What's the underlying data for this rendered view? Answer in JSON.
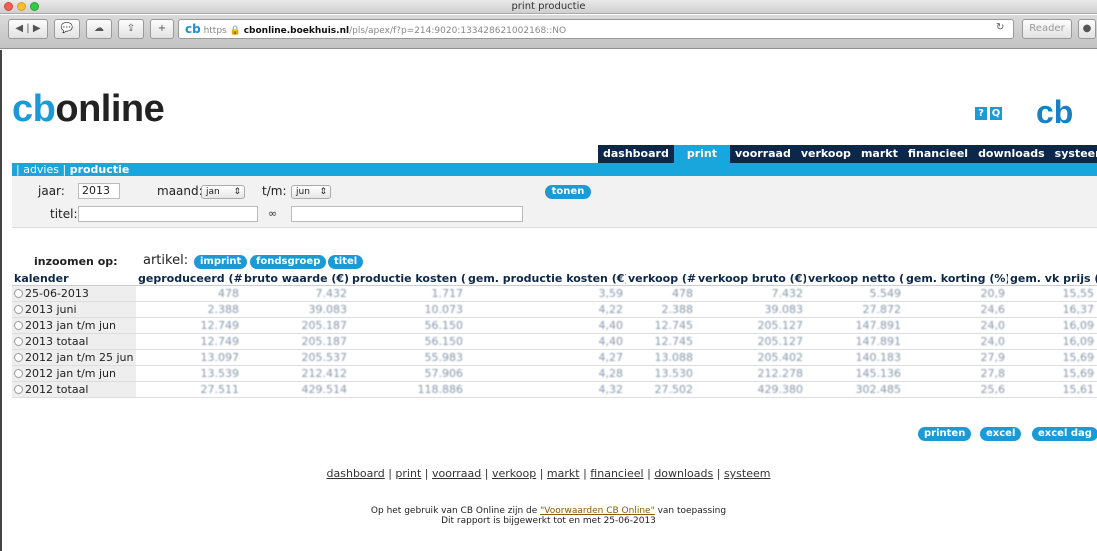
{
  "window": {
    "title": "print productie"
  },
  "browser": {
    "url_prefix": "https",
    "url_host": "cbonline.boekhuis.nl",
    "url_path": "/pls/apex/f?p=214:9020:133428621002168::NO",
    "reader_label": "Reader"
  },
  "logo": {
    "brand_c": "cb",
    "brand_rest": "online"
  },
  "icons": {
    "help": "?",
    "search": "Q"
  },
  "mainnav": [
    {
      "label": "dashboard",
      "active": false
    },
    {
      "label": "print",
      "active": true
    },
    {
      "label": "voorraad",
      "active": false
    },
    {
      "label": "verkoop",
      "active": false
    },
    {
      "label": "markt",
      "active": false
    },
    {
      "label": "financieel",
      "active": false
    },
    {
      "label": "downloads",
      "active": false
    },
    {
      "label": "systeem",
      "active": false
    }
  ],
  "subnav": {
    "advies": "advies",
    "productie": "productie"
  },
  "filter": {
    "jaar_label": "jaar:",
    "jaar_value": "2013",
    "maand_label": "maand:",
    "maand_value": "jan",
    "tm_label": "t/m:",
    "tm_value": "jun",
    "tonen_label": "tonen",
    "titel_label": "titel:",
    "titel_value": "",
    "search_value": ""
  },
  "zoom": {
    "label": "inzoomen op:",
    "artikel_label": "artikel:",
    "buttons": [
      "imprint",
      "fondsgroep",
      "titel"
    ]
  },
  "table": {
    "columns": [
      "kalender",
      "geproduceerd (#)",
      "bruto waarde (€)",
      "productie kosten (€)",
      "gem. productie kosten (€)",
      "verkoop (#)",
      "verkoop bruto (€)",
      "verkoop netto (€)",
      "gem. korting (%)",
      "gem. vk prijs (€)"
    ],
    "rows": [
      [
        "25-06-2013",
        "478",
        "7.432",
        "1.717",
        "3,59",
        "478",
        "7.432",
        "5.549",
        "20,9",
        "15,55"
      ],
      [
        "2013 juni",
        "2.388",
        "39.083",
        "10.073",
        "4,22",
        "2.388",
        "39.083",
        "27.872",
        "24,6",
        "16,37"
      ],
      [
        "2013 jan t/m jun",
        "12.749",
        "205.187",
        "56.150",
        "4,40",
        "12.745",
        "205.127",
        "147.891",
        "24,0",
        "16,09"
      ],
      [
        "2013 totaal",
        "12.749",
        "205.187",
        "56.150",
        "4,40",
        "12.745",
        "205.127",
        "147.891",
        "24,0",
        "16,09"
      ],
      [
        "2012 jan t/m 25 jun",
        "13.097",
        "205.537",
        "55.983",
        "4,27",
        "13.088",
        "205.402",
        "140.183",
        "27,9",
        "15,69"
      ],
      [
        "2012 jan t/m jun",
        "13.539",
        "212.412",
        "57.906",
        "4,28",
        "13.530",
        "212.278",
        "145.136",
        "27,8",
        "15,69"
      ],
      [
        "2012 totaal",
        "27.511",
        "429.514",
        "118.886",
        "4,32",
        "27.502",
        "429.380",
        "302.485",
        "25,6",
        "15,61"
      ]
    ]
  },
  "actions": {
    "printen": "printen",
    "excel": "excel",
    "excel_dag": "excel dag"
  },
  "footer": {
    "links": [
      "dashboard",
      "print",
      "voorraad",
      "verkoop",
      "markt",
      "financieel",
      "downloads",
      "systeem"
    ],
    "terms_prefix": "Op het gebruik van CB Online zijn de ",
    "terms_link": "\"Voorwaarden CB Online\"",
    "terms_suffix": " van toepassing",
    "report_note": "Dit rapport is bijgewerkt tot en met 25-06-2013"
  },
  "colors": {
    "navy": "#0c2748",
    "accent": "#19a6dc"
  }
}
